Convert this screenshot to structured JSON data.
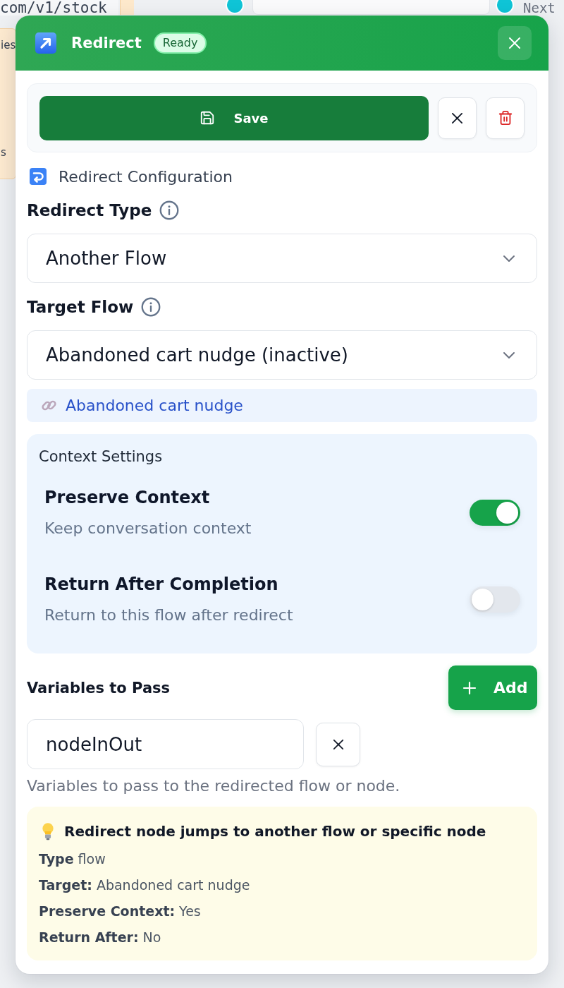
{
  "canvas": {
    "code_text": "com/v1/stock",
    "side_node_texts": [
      "ies",
      "s"
    ],
    "next_label": "Next"
  },
  "header": {
    "title": "Redirect",
    "status": "Ready"
  },
  "toolbar": {
    "save_label": "Save"
  },
  "section": {
    "title": "Redirect Configuration"
  },
  "fields": [
    {
      "label": "Redirect Type",
      "value": "Another Flow"
    },
    {
      "label": "Target Flow",
      "value": "Abandoned cart nudge (inactive)"
    }
  ],
  "target_link": {
    "label": "Abandoned cart nudge"
  },
  "context_settings": {
    "title": "Context Settings",
    "toggles": [
      {
        "label": "Preserve Context",
        "description": "Keep conversation context",
        "on": true
      },
      {
        "label": "Return After Completion",
        "description": "Return to this flow after redirect",
        "on": false
      }
    ]
  },
  "variables": {
    "title": "Variables to Pass",
    "add_label": "Add",
    "items": [
      {
        "value": "nodeInOut"
      }
    ],
    "hint": "Variables to pass to the redirected flow or node."
  },
  "summary": {
    "title": "Redirect node jumps to another flow or specific node",
    "lines": [
      "**Type** flow",
      "**Target:** Abandoned cart nudge",
      "**Preserve Context:** Yes",
      "**Return After:** No"
    ]
  }
}
